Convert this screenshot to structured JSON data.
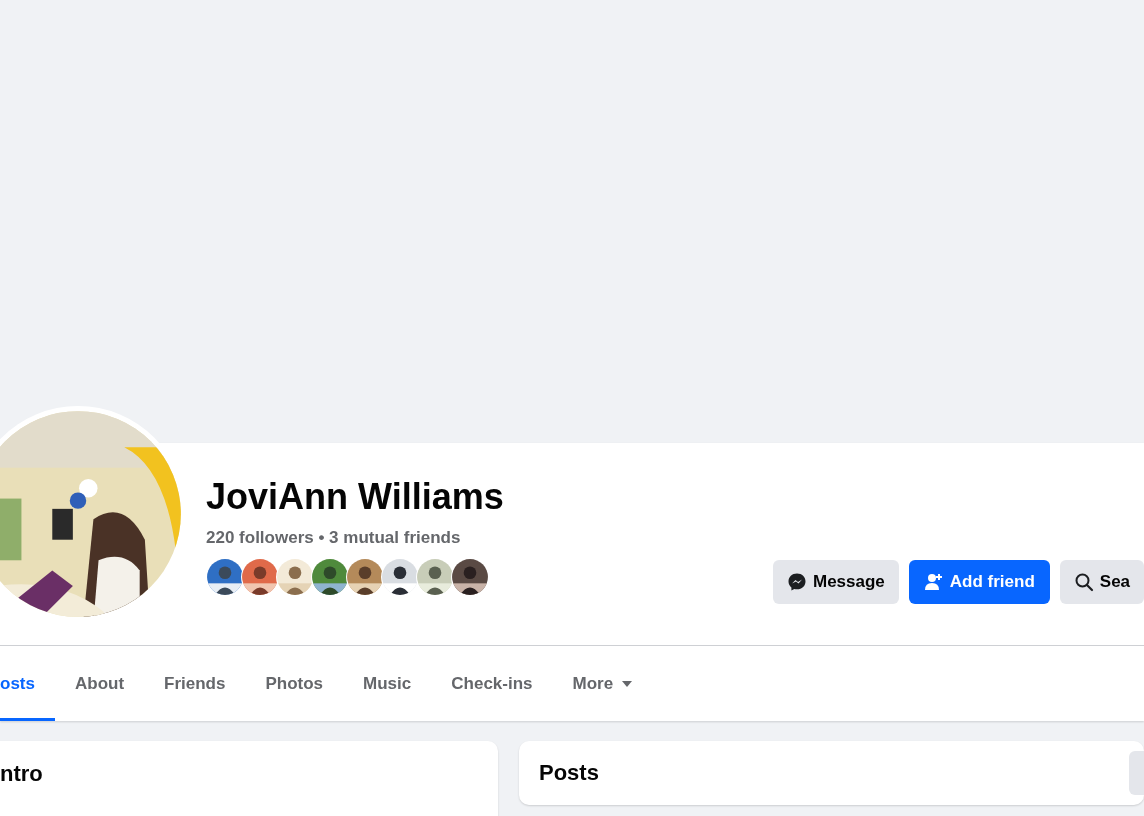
{
  "profile": {
    "name": "JoviAnn Williams",
    "stats": "220 followers • 3 mutual friends"
  },
  "actions": [
    {
      "kind": "message",
      "label": "Message"
    },
    {
      "kind": "add",
      "label": "Add friend"
    },
    {
      "kind": "search",
      "label": "Sea"
    }
  ],
  "tabs": [
    {
      "label": "osts",
      "selected": true,
      "caret": false
    },
    {
      "label": "About",
      "selected": false,
      "caret": false
    },
    {
      "label": "Friends",
      "selected": false,
      "caret": false
    },
    {
      "label": "Photos",
      "selected": false,
      "caret": false
    },
    {
      "label": "Music",
      "selected": false,
      "caret": false
    },
    {
      "label": "Check-ins",
      "selected": false,
      "caret": false
    },
    {
      "label": "More",
      "selected": false,
      "caret": true
    }
  ],
  "intro": {
    "title": "ntro"
  },
  "posts": {
    "title": "Posts"
  }
}
